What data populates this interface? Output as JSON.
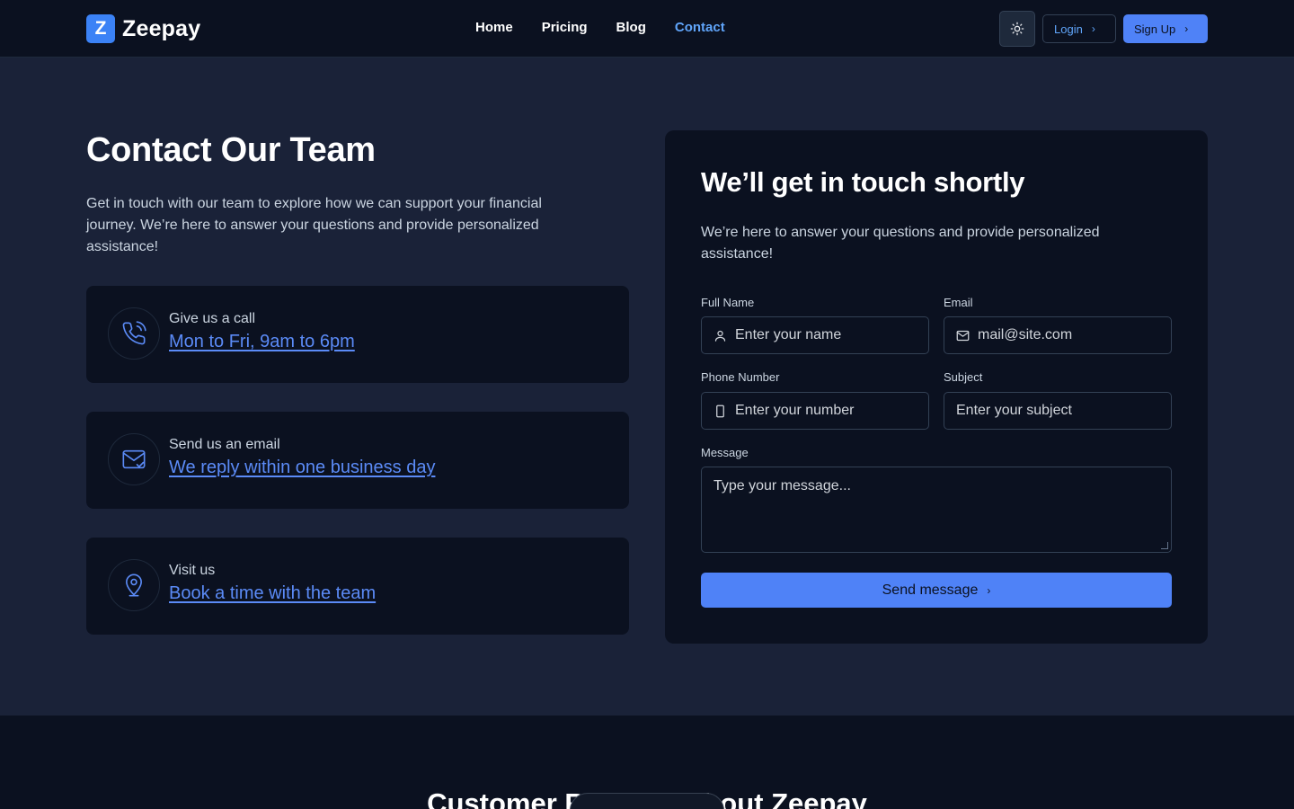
{
  "nav": {
    "brand_mark": "Z",
    "brand_name": "Zeepay",
    "links": [
      "Home",
      "Pricing",
      "Blog",
      "Contact"
    ],
    "active": "Contact",
    "login": "Login",
    "signup": "Sign Up"
  },
  "hero": {
    "title": "Contact Our Team",
    "lead": "Get in touch with our team to explore how we can support your financial journey. We’re here to answer your questions and provide personalized assistance!"
  },
  "cards": [
    {
      "label": "Give us a call",
      "link": "Mon to Fri, 9am to 6pm",
      "icon": "phone-icon"
    },
    {
      "label": "Send us an email",
      "link": "We reply within one business day",
      "icon": "mail-icon"
    },
    {
      "label": "Visit us",
      "link": "Book a time with the team",
      "icon": "location-pin-icon"
    }
  ],
  "form": {
    "title": "We’ll get in touch shortly",
    "subtitle": "We’re here to answer your questions and provide personalized assistance!",
    "full_name_label": "Full Name",
    "full_name_placeholder": "Enter your name",
    "email_label": "Email",
    "email_placeholder": "mail@site.com",
    "phone_label": "Phone Number",
    "phone_placeholder": "Enter your number",
    "subject_label": "Subject",
    "subject_placeholder": "Enter your subject",
    "message_label": "Message",
    "message_placeholder": "Type your message...",
    "submit": "Send message"
  },
  "bottom": {
    "title": "Customer Reviews About Zeepay"
  },
  "colors": {
    "accent": "#4f82f7",
    "link": "#5b8bf7",
    "page_bg": "#1a2238",
    "card_bg": "#0b1120"
  }
}
